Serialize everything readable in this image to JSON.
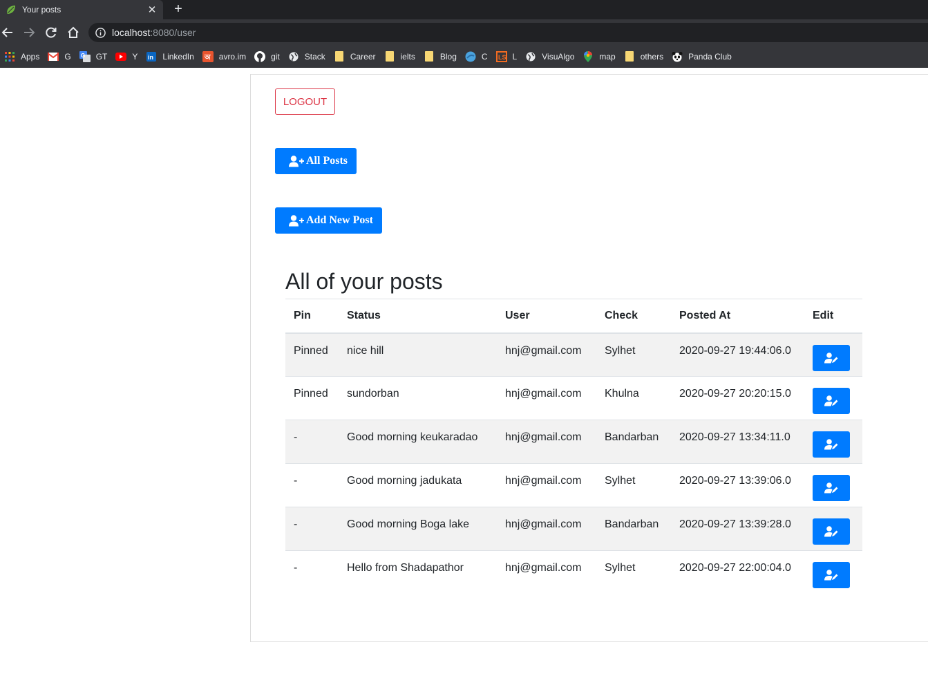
{
  "browser": {
    "tab_title": "Your posts",
    "url_host": "localhost",
    "url_rest": ":8080/user",
    "bookmarks": [
      {
        "label": "Apps",
        "icon": "apps-grid-icon",
        "color": "#ea4335"
      },
      {
        "label": "G",
        "icon": "gmail-icon",
        "color": "#ea4335"
      },
      {
        "label": "GT",
        "icon": "google-translate-icon",
        "color": "#4285f4"
      },
      {
        "label": "Y",
        "icon": "youtube-icon",
        "color": "#ff0000"
      },
      {
        "label": "LinkedIn",
        "icon": "linkedin-icon",
        "color": "#0a66c2"
      },
      {
        "label": "avro.im",
        "icon": "avro-icon",
        "color": "#e8542e"
      },
      {
        "label": "git",
        "icon": "github-icon",
        "color": "#ffffff"
      },
      {
        "label": "Stack",
        "icon": "globe-icon",
        "color": "#e8eaed"
      },
      {
        "label": "Career",
        "icon": "folder-icon",
        "color": "#f7d774"
      },
      {
        "label": "ielts",
        "icon": "folder-icon",
        "color": "#f7d774"
      },
      {
        "label": "Blog",
        "icon": "folder-icon",
        "color": "#f7d774"
      },
      {
        "label": "C",
        "icon": "blue-circle-icon",
        "color": "#4aa3df"
      },
      {
        "label": "L",
        "icon": "ls-icon",
        "color": "#f26b21"
      },
      {
        "label": "VisuAlgo",
        "icon": "globe-icon",
        "color": "#e8eaed"
      },
      {
        "label": "map",
        "icon": "maps-pin-icon",
        "color": "#34a853"
      },
      {
        "label": "others",
        "icon": "folder-icon",
        "color": "#f7d774"
      },
      {
        "label": "Panda Club",
        "icon": "panda-icon",
        "color": "#ffffff"
      }
    ]
  },
  "page": {
    "logout_label": "LOGOUT",
    "all_posts_label": "All Posts",
    "add_post_label": "Add New Post",
    "heading": "All of your posts",
    "colors": {
      "primary": "#007bff",
      "danger": "#dc3545",
      "stripe": "#f2f2f2"
    }
  },
  "table": {
    "headers": {
      "pin": "Pin",
      "status": "Status",
      "user": "User",
      "check": "Check",
      "posted_at": "Posted At",
      "edit": "Edit"
    },
    "rows": [
      {
        "pin": "Pinned",
        "status": "nice hill",
        "user": "hnj@gmail.com",
        "check": "Sylhet",
        "posted_at": "2020-09-27 19:44:06.0"
      },
      {
        "pin": "Pinned",
        "status": "sundorban",
        "user": "hnj@gmail.com",
        "check": "Khulna",
        "posted_at": "2020-09-27 20:20:15.0"
      },
      {
        "pin": "-",
        "status": "Good morning keukaradao",
        "user": "hnj@gmail.com",
        "check": "Bandarban",
        "posted_at": "2020-09-27 13:34:11.0"
      },
      {
        "pin": "-",
        "status": "Good morning jadukata",
        "user": "hnj@gmail.com",
        "check": "Sylhet",
        "posted_at": "2020-09-27 13:39:06.0"
      },
      {
        "pin": "-",
        "status": "Good morning Boga lake",
        "user": "hnj@gmail.com",
        "check": "Bandarban",
        "posted_at": "2020-09-27 13:39:28.0"
      },
      {
        "pin": "-",
        "status": "Hello from Shadapathor",
        "user": "hnj@gmail.com",
        "check": "Sylhet",
        "posted_at": "2020-09-27 22:00:04.0"
      }
    ]
  }
}
